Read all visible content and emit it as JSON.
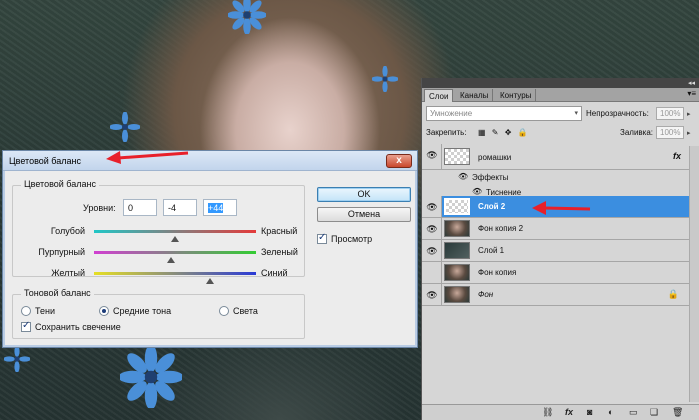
{
  "colors": {
    "selected_layer": "#3b8ee0",
    "arrow": "#e8202a",
    "flower": "#4a8fd8"
  },
  "dialog": {
    "title": "Цветовой баланс",
    "close_glyph": "x",
    "balance_group": "Цветовой баланс",
    "levels_label": "Уровни:",
    "levels": [
      "0",
      "-4",
      "+44"
    ],
    "sliders": [
      {
        "left": "Голубой",
        "right": "Красный",
        "value": 0
      },
      {
        "left": "Пурпурный",
        "right": "Зеленый",
        "value": -4
      },
      {
        "left": "Желтый",
        "right": "Синий",
        "value": 44
      }
    ],
    "tone_group": "Тоновой баланс",
    "tones": [
      {
        "label": "Тени",
        "selected": false
      },
      {
        "label": "Средние тона",
        "selected": true
      },
      {
        "label": "Света",
        "selected": false
      }
    ],
    "preserve_luminosity": "Сохранить свечение",
    "ok": "OK",
    "cancel": "Отмена",
    "preview": "Просмотр"
  },
  "layers_panel": {
    "collapse_glyph": "◂◂",
    "tabs": [
      "Слои",
      "Каналы",
      "Контуры"
    ],
    "menu_glyph": "▾≡",
    "blend_mode": "Умножение",
    "opacity_label": "Непрозрачность:",
    "opacity_value": "100%",
    "lock_label": "Закрепить:",
    "fill_label": "Заливка:",
    "fill_value": "100%",
    "layers": [
      {
        "name": "ромашки",
        "thumb": "checker",
        "fx": "fx",
        "visible": true,
        "selected": false
      },
      {
        "name": "Слой 2",
        "thumb": "checker",
        "visible": true,
        "selected": true
      },
      {
        "name": "Фон копия 2",
        "thumb": "photo",
        "visible": true,
        "selected": false
      },
      {
        "name": "Слой 1",
        "thumb": "dark",
        "visible": true,
        "selected": false
      },
      {
        "name": "Фон копия",
        "thumb": "photo",
        "visible": false,
        "selected": false
      },
      {
        "name": "Фон",
        "thumb": "photo",
        "visible": true,
        "selected": false,
        "locked": true
      }
    ],
    "effects_label": "Эффекты",
    "effect_item": "Тиснение",
    "bottom_icons": [
      "link-icon",
      "fx-icon",
      "mask-icon",
      "adjustment-icon",
      "group-icon",
      "new-layer-icon",
      "trash-icon"
    ]
  }
}
